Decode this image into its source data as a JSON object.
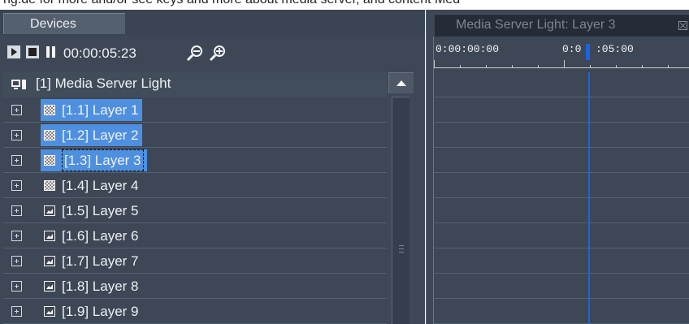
{
  "top_strip_text": "ng.de for more and/or see keys and more about media server, and content Med",
  "devices_panel": {
    "tab_label": "Devices",
    "toolbar": {
      "time": "00:00:05:23",
      "icons": [
        "play-icon",
        "stop-icon",
        "pause-icon",
        "zoom-out-icon",
        "zoom-in-icon"
      ]
    },
    "root": {
      "label": "[1] Media Server Light",
      "icon": "device-icon"
    },
    "layers": [
      {
        "label": "[1.1] Layer 1",
        "icon": "checker-layer-icon",
        "selected": true
      },
      {
        "label": "[1.2] Layer 2",
        "icon": "checker-layer-icon",
        "selected": true
      },
      {
        "label": "[1.3] Layer 3",
        "icon": "checker-layer-icon",
        "selected": true,
        "focused": true
      },
      {
        "label": "[1.4] Layer 4",
        "icon": "checker-layer-icon",
        "selected": false
      },
      {
        "label": "[1.5] Layer 5",
        "icon": "image-layer-icon",
        "selected": false
      },
      {
        "label": "[1.6] Layer 6",
        "icon": "image-layer-icon",
        "selected": false
      },
      {
        "label": "[1.7] Layer 7",
        "icon": "image-layer-icon",
        "selected": false
      },
      {
        "label": "[1.8] Layer 8",
        "icon": "image-layer-icon",
        "selected": false
      },
      {
        "label": "[1.9] Layer 9",
        "icon": "image-layer-icon",
        "selected": false
      }
    ]
  },
  "timeline_panel": {
    "tab_title": "Media Server Light: Layer 3",
    "ruler_labels": [
      "0:00:00:00",
      "0:0",
      ":05:00"
    ],
    "playhead_color": "#1a64e8"
  },
  "colors": {
    "panel_bg": "#3d4756",
    "selection": "#4e90df"
  }
}
